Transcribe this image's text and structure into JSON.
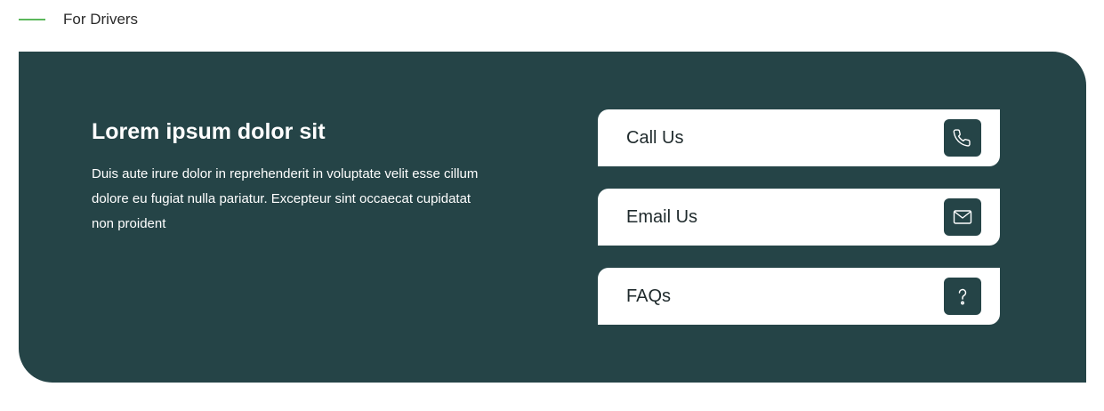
{
  "eyebrow": {
    "label": "For Drivers"
  },
  "intro": {
    "title": "Lorem ipsum dolor sit",
    "body": "Duis aute irure dolor in reprehenderit in voluptate velit esse cillum dolore eu fugiat nulla pariatur. Excepteur sint occaecat cupidatat non proident"
  },
  "actions": [
    {
      "label": "Call Us",
      "icon": "phone-icon"
    },
    {
      "label": "Email Us",
      "icon": "envelope-icon"
    },
    {
      "label": "FAQs",
      "icon": "question-icon"
    }
  ],
  "colors": {
    "panel": "#254447",
    "accent": "#5cb85c",
    "card": "#ffffff",
    "icon_bg": "#254447"
  }
}
